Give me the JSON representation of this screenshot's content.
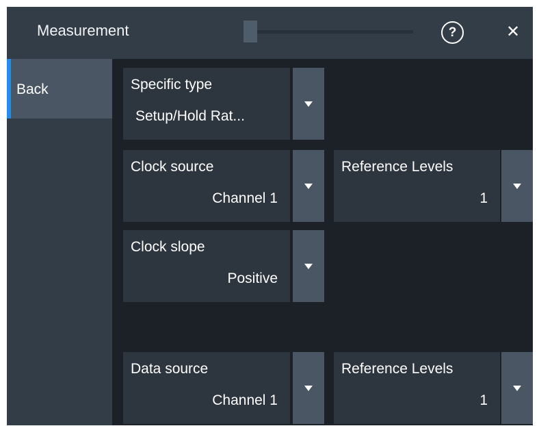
{
  "dialog": {
    "title": "Measurement",
    "help_icon": "?",
    "close_icon": "✕"
  },
  "sidebar": {
    "back_label": "Back"
  },
  "controls": {
    "specific_type": {
      "label": "Specific type",
      "value": "Setup/Hold Rat..."
    },
    "clock_source": {
      "label": "Clock source",
      "value": "Channel 1"
    },
    "clock_reference_levels": {
      "label": "Reference Levels",
      "value": "1"
    },
    "clock_slope": {
      "label": "Clock slope",
      "value": "Positive"
    },
    "data_source": {
      "label": "Data source",
      "value": "Channel 1"
    },
    "data_reference_levels": {
      "label": "Reference Levels",
      "value": "1"
    }
  },
  "icons": {
    "dropdown": "triangle-down-icon",
    "help": "question-circle-icon",
    "close": "close-icon"
  },
  "colors": {
    "accent": "#1c8df2",
    "background": "#1c2127",
    "panel": "#323d47",
    "control": "#2d353e",
    "dropdown_button": "#4a5663"
  }
}
